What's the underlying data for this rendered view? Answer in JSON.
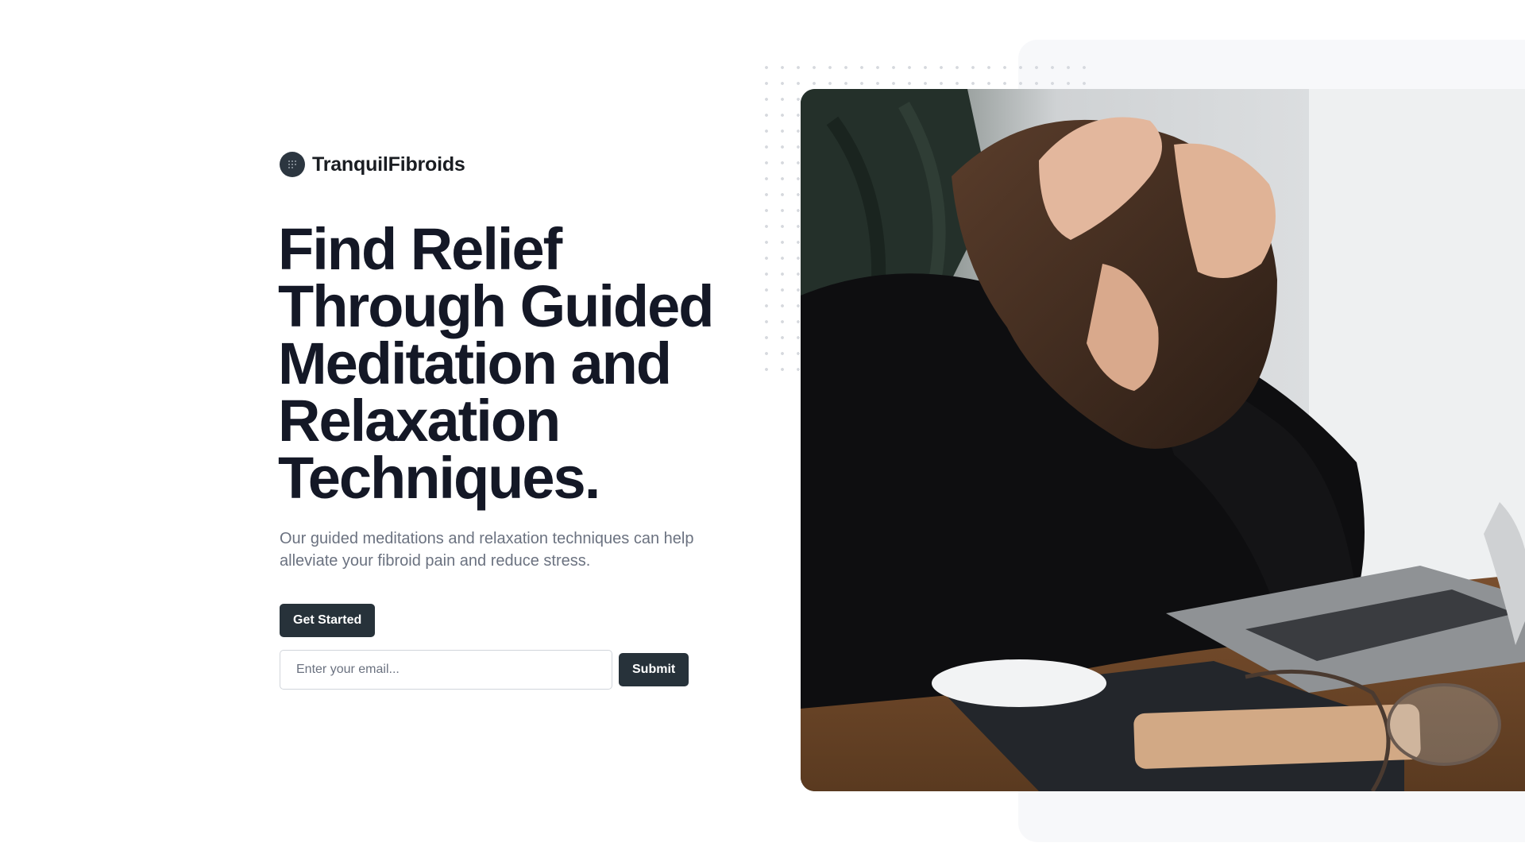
{
  "brand": {
    "name": "TranquilFibroids",
    "logo_icon": "grid-dots-icon"
  },
  "hero": {
    "headline": "Find Relief Through Guided Meditation and Relaxation Techniques.",
    "subtext": "Our guided meditations and relaxation techniques can help alleviate your fibroid pain and reduce stress.",
    "cta_label": "Get Started"
  },
  "signup": {
    "email_placeholder": "Enter your email...",
    "submit_label": "Submit"
  },
  "colors": {
    "headline": "#141826",
    "button_bg": "#27323a",
    "subtext": "#6b7280",
    "panel_bg": "#f7f8fa"
  }
}
